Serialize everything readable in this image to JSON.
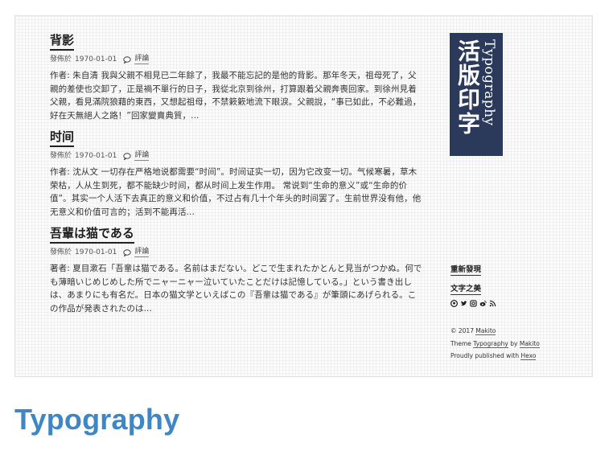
{
  "posts": [
    {
      "title": "背影",
      "meta_prefix": "發佈於",
      "date": "1970-01-01",
      "comment_label": "評論",
      "excerpt": "作者: 朱自清 我與父親不相見已二年餘了，我最不能忘記的是他的背影。那年冬天，祖母死了，父親的差使也交卸了，正是禍不單行的日子，我從北京到徐州，打算跟着父親奔喪回家。到徐州見着父親，看見滿院狼藉的東西，又想起祖母，不禁簌簌地流下眼淚。父親說，“事已如此，不必難過，好在天無絕人之路！”回家變賣典質，..."
    },
    {
      "title": "时间",
      "meta_prefix": "發佈於",
      "date": "1970-01-01",
      "comment_label": "評論",
      "excerpt": "作者: 沈从文 一切存在严格地说都需要“时间”。时间证实一切，因为它改变一切。气候寒暑，草木荣枯，人从生到死，都不能缺少时间，都从时间上发生作用。 常说到“生命的意义”或“生命的价值”。其实一个人活下去真正的意义和价值，不过占有几十个年头的时间罢了。生前世界没有他，他无意义和价值可言的；活到不能再活..."
    },
    {
      "title": "吾輩は猫である",
      "meta_prefix": "發佈於",
      "date": "1970-01-01",
      "comment_label": "評論",
      "excerpt": "著者: 夏目漱石「吾輩は猫である。名前はまだない。どこで生まれたかとんと見当がつかぬ。何でも薄暗いじめじめした所でニャーニャー泣いていたことだけは記憶している。」という書き出しは、あまりにも有名だ。日本の猫文学といえばこの『吾輩は猫である』が筆頭にあげられる。この作品が発表されたのは..."
    }
  ],
  "logo": {
    "cjk": "活版印字",
    "latin": "Typography",
    "bg_color": "#2b3a5a"
  },
  "nav": {
    "items": [
      "重新發現",
      "文字之美"
    ],
    "social_icons": [
      "github-icon",
      "twitter-icon",
      "instagram-icon",
      "weibo-icon",
      "rss-icon"
    ]
  },
  "footer": {
    "copyright_prefix": "© 2017",
    "author": "Makito",
    "theme_prefix": "Theme",
    "theme_name": "Typography",
    "by": "by",
    "theme_author": "Makito",
    "published_prefix": "Proudly published with",
    "engine": "Hexo"
  },
  "caption": {
    "text": "Typography",
    "color": "#3f86c4"
  }
}
